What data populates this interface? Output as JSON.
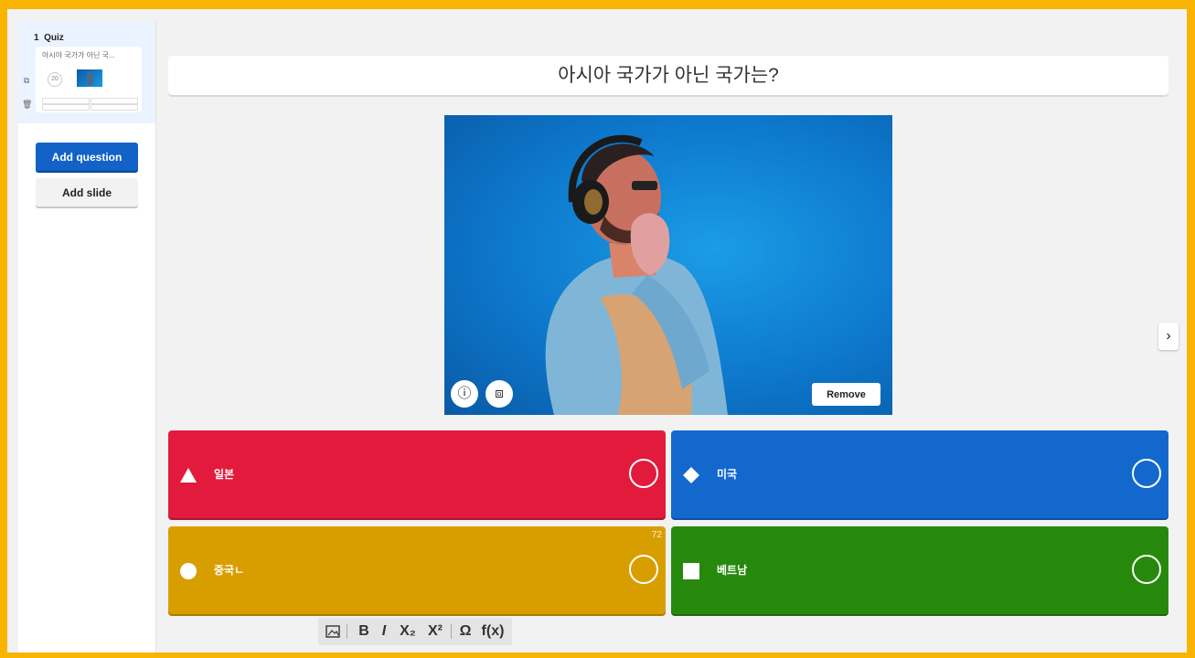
{
  "sidebar": {
    "slide_number": "1",
    "slide_type": "Quiz",
    "thumb_title": "아시아 국가가 아닌 국...",
    "thumb_timer": "20",
    "add_question": "Add question",
    "add_slide": "Add slide"
  },
  "question": {
    "text": "아시아 국가가 아닌 국가는?"
  },
  "image": {
    "remove_label": "Remove",
    "info_icon": "info-icon",
    "crop_icon": "crop-icon"
  },
  "answers": [
    {
      "label": "일본",
      "color": "#e21b3c",
      "shape": "triangle"
    },
    {
      "label": "미국",
      "color": "#1368ce",
      "shape": "diamond"
    },
    {
      "label": "중국ㄴ",
      "color": "#d89e00",
      "shape": "circle",
      "char_count": "72"
    },
    {
      "label": "베트남",
      "color": "#26890c",
      "shape": "square"
    }
  ],
  "toolbar": {
    "bold": "B",
    "italic": "I",
    "subscript": "X₂",
    "superscript": "X²",
    "special_char": "Ω",
    "formula": "f(x)"
  },
  "colors": {
    "frame": "#f8b400",
    "primary_button": "#1262c8"
  }
}
